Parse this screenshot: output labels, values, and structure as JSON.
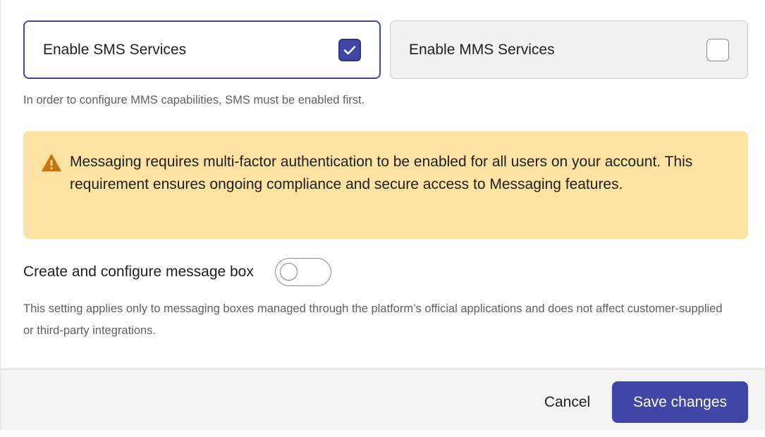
{
  "sms_option": {
    "label": "Enable SMS Services",
    "checked": true
  },
  "mms_option": {
    "label": "Enable MMS Services",
    "checked": false
  },
  "mms_hint": "In order to configure MMS capabilities, SMS must be enabled first.",
  "warning": {
    "icon": "warning-triangle-icon",
    "text": "Messaging requires multi-factor authentication to be enabled for all users on your account. This requirement ensures ongoing compliance and secure access to Messaging features."
  },
  "message_box": {
    "label": "Create and configure message box",
    "enabled": false,
    "description": "This setting applies only to messaging boxes managed through the platform’s official applications and does not affect customer-supplied or third-party integrations."
  },
  "footer": {
    "cancel_label": "Cancel",
    "save_label": "Save changes"
  },
  "colors": {
    "accent": "#3f46a6",
    "warning_bg": "#fce2a3",
    "warning_icon": "#c8760d",
    "footer_bg": "#f3f3f4"
  }
}
